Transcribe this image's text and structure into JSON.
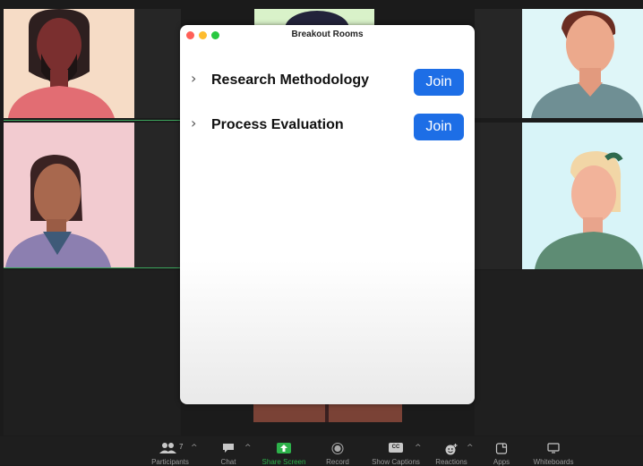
{
  "dialog": {
    "title": "Breakout Rooms",
    "traffic_lights": {
      "close": "#ff5f57",
      "minimize": "#febc2e",
      "zoom": "#28c840"
    },
    "rooms": [
      {
        "name": "Research Methodology",
        "join_label": "Join"
      },
      {
        "name": "Process Evaluation",
        "join_label": "Join"
      }
    ],
    "join_color": "#1d6ee6"
  },
  "toolbar": {
    "participants": {
      "label": "Participants",
      "count": "7"
    },
    "chat": {
      "label": "Chat"
    },
    "share": {
      "label": "Share Screen"
    },
    "record": {
      "label": "Record"
    },
    "captions": {
      "label": "Show Captions",
      "icon_text": "CC"
    },
    "reactions": {
      "label": "Reactions"
    },
    "apps": {
      "label": "Apps"
    },
    "whiteboards": {
      "label": "Whiteboards"
    },
    "accent": "#2db14a"
  }
}
